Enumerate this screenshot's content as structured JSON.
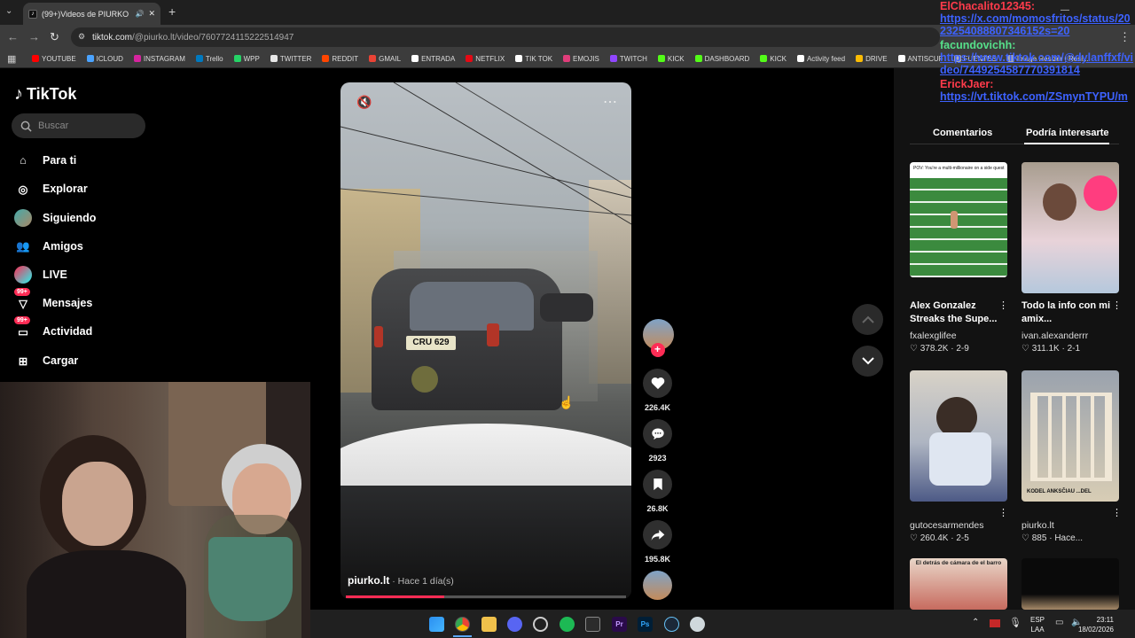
{
  "browser": {
    "tab_title": "(99+)Videos de PIURKO (@...",
    "url_host": "tiktok.com",
    "url_path": "/@piurko.lt/video/7607724115222514947",
    "bookmarks": [
      {
        "label": "YOUTUBE",
        "color": "#ff0000"
      },
      {
        "label": "ICLOUD",
        "color": "#4aa3ff"
      },
      {
        "label": "INSTAGRAM",
        "color": "#d6249f"
      },
      {
        "label": "Trello",
        "color": "#0079bf"
      },
      {
        "label": "WPP",
        "color": "#25d366"
      },
      {
        "label": "TWITTER",
        "color": "#e8e8e8"
      },
      {
        "label": "REDDIT",
        "color": "#ff4500"
      },
      {
        "label": "GMAIL",
        "color": "#ea4335"
      },
      {
        "label": "ENTRADA",
        "color": "#ffffff"
      },
      {
        "label": "NETFLIX",
        "color": "#e50914"
      },
      {
        "label": "TIK TOK",
        "color": "#ffffff"
      },
      {
        "label": "EMOJIS",
        "color": "#e03d7a"
      },
      {
        "label": "TWITCH",
        "color": "#9146ff"
      },
      {
        "label": "KICK",
        "color": "#53fc18"
      },
      {
        "label": "DASHBOARD",
        "color": "#53fc18"
      },
      {
        "label": "KICK",
        "color": "#53fc18"
      },
      {
        "label": "Activity feed",
        "color": "#ffffff"
      },
      {
        "label": "DRIVE",
        "color": "#fbbc04"
      },
      {
        "label": "ANTISCUF",
        "color": "#ffffff"
      },
      {
        "label": "FUENTES",
        "color": "#aaaaaa"
      },
      {
        "label": "Image Resizer | Resi...",
        "color": "#aaaaaa"
      }
    ]
  },
  "sidebar": {
    "logo": "TikTok",
    "search_placeholder": "Buscar",
    "items": [
      {
        "label": "Para ti",
        "icon": "home-icon"
      },
      {
        "label": "Explorar",
        "icon": "compass-icon"
      },
      {
        "label": "Siguiendo",
        "icon": "avatar-icon"
      },
      {
        "label": "Amigos",
        "icon": "friends-icon"
      },
      {
        "label": "LIVE",
        "icon": "live-icon"
      },
      {
        "label": "Mensajes",
        "icon": "message-icon",
        "badge": "99+"
      },
      {
        "label": "Actividad",
        "icon": "bell-icon",
        "badge": "99+"
      },
      {
        "label": "Cargar",
        "icon": "upload-icon"
      }
    ]
  },
  "video": {
    "author": "piurko.lt",
    "time": " · Hace 1 día(s)",
    "plate": "CRU 629",
    "progress": 0.35
  },
  "actions": {
    "likes": "226.4K",
    "comments": "2923",
    "saves": "26.8K",
    "shares": "195.8K"
  },
  "right_panel": {
    "tabs": [
      "Comentarios",
      "Podría interesarte"
    ],
    "videos": [
      {
        "title": "Alex Gonzalez Streaks the Supe...",
        "author": "fxalexglifee",
        "stats": "♡ 378.2K · 2-9",
        "caption": "POV: You're a multi-millionaire on a side quest"
      },
      {
        "title": "Todo la info con mi amix...",
        "author": "ivan.alexanderrr",
        "stats": "♡ 311.1K · 2-1",
        "caption": ""
      },
      {
        "title": "",
        "author": "gutocesarmendes",
        "stats": "♡ 260.4K · 2-5",
        "caption": ""
      },
      {
        "title": "",
        "author": "piurko.lt",
        "stats": "♡ 885 · Hace...",
        "caption": "KODEL ANKSČIAU ...DEL"
      },
      {
        "title": "",
        "author": "",
        "stats": "",
        "caption": "El detrás de cámara de el barro"
      },
      {
        "title": "",
        "author": "",
        "stats": "",
        "caption": ""
      }
    ]
  },
  "chat": [
    {
      "name": "ElChacalito12345:",
      "text": "https://x.com/momosfritos/status/2023254088807346152s=20",
      "name_color": "red"
    },
    {
      "name": "facundovichh:",
      "text": "https://www.tiktok.com/@dylanffxf/video/7449254587770391814",
      "name_color": "green"
    },
    {
      "name": "ErickJaer:",
      "text": "https://vt.tiktok.com/ZSmynTYPU/m",
      "name_color": "red"
    }
  ],
  "taskbar": {
    "lang_top": "ESP",
    "lang_bottom": "LAA",
    "time": "23:11",
    "date": "18/02/2026"
  }
}
